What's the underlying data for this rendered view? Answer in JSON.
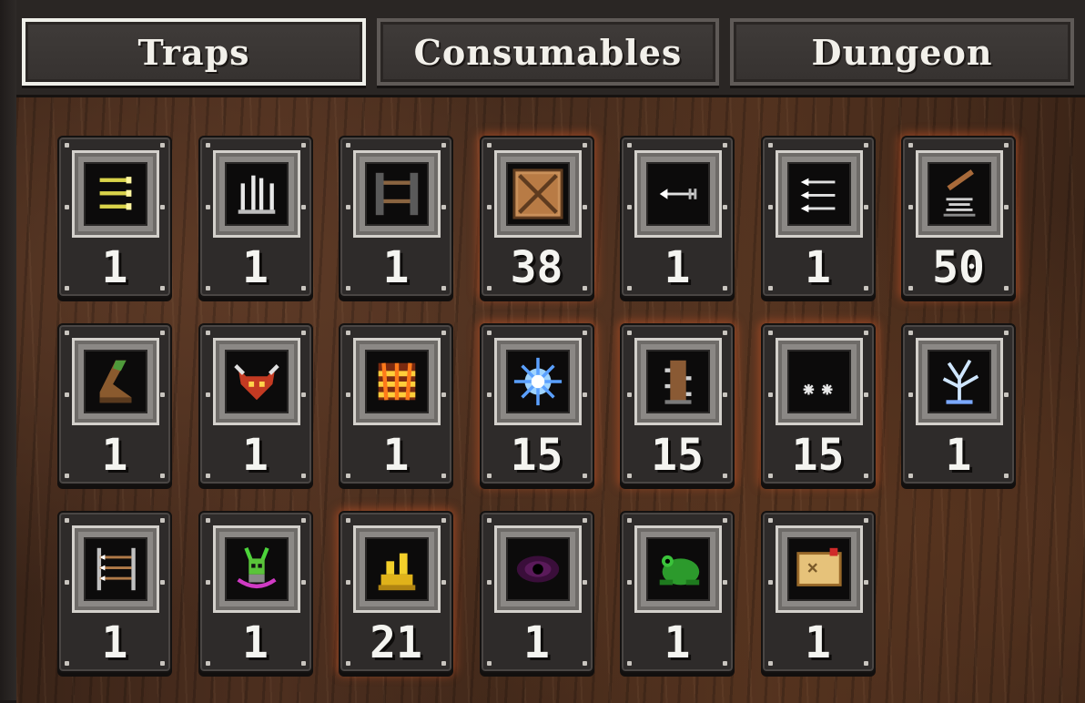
{
  "tabs": [
    {
      "label": "Traps",
      "active": true
    },
    {
      "label": "Consumables",
      "active": false
    },
    {
      "label": "Dungeon",
      "active": false
    }
  ],
  "items": [
    {
      "icon": "arrow-volley-icon",
      "count": "1",
      "glow": false
    },
    {
      "icon": "spike-trap-icon",
      "count": "1",
      "glow": false
    },
    {
      "icon": "ladder-icon",
      "count": "1",
      "glow": false
    },
    {
      "icon": "crate-icon",
      "count": "38",
      "glow": true
    },
    {
      "icon": "arrow-shot-icon",
      "count": "1",
      "glow": false
    },
    {
      "icon": "triple-arrow-icon",
      "count": "1",
      "glow": false
    },
    {
      "icon": "spring-trap-icon",
      "count": "50",
      "glow": true
    },
    {
      "icon": "boot-trap-icon",
      "count": "1",
      "glow": false
    },
    {
      "icon": "demon-mask-icon",
      "count": "1",
      "glow": false
    },
    {
      "icon": "fire-grid-icon",
      "count": "1",
      "glow": false
    },
    {
      "icon": "ice-burst-icon",
      "count": "15",
      "glow": true
    },
    {
      "icon": "totem-trap-icon",
      "count": "15",
      "glow": true
    },
    {
      "icon": "caltrops-icon",
      "count": "15",
      "glow": true
    },
    {
      "icon": "lightning-tree-icon",
      "count": "1",
      "glow": false
    },
    {
      "icon": "arrow-rack-icon",
      "count": "1",
      "glow": false
    },
    {
      "icon": "horned-idol-icon",
      "count": "1",
      "glow": false
    },
    {
      "icon": "gold-pile-icon",
      "count": "21",
      "glow": true
    },
    {
      "icon": "void-eye-icon",
      "count": "1",
      "glow": false
    },
    {
      "icon": "frog-icon",
      "count": "1",
      "glow": false
    },
    {
      "icon": "treasure-map-icon",
      "count": "1",
      "glow": false
    }
  ]
}
